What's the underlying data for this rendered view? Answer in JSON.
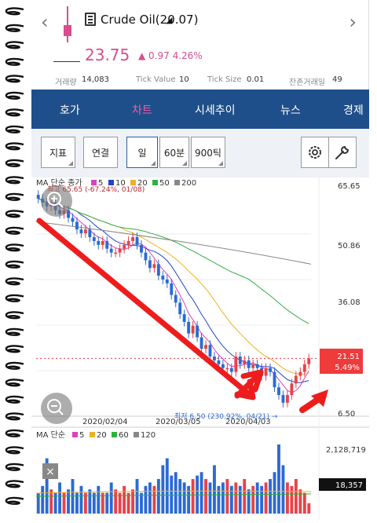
{
  "header": {
    "title": "Crude Oil(20.07)",
    "price": "23.75",
    "change": "▲ 0.97 4.26%"
  },
  "info": {
    "volume_label": "거래량",
    "volume_value": "14,083",
    "tick_value_label": "Tick Value",
    "tick_value_value": "10",
    "tick_size_label": "Tick Size",
    "tick_size_value": "0.01",
    "days_left_label": "잔존거래일",
    "days_left_value": "49"
  },
  "tabs": [
    "호가",
    "차트",
    "시세추이",
    "뉴스",
    "경제"
  ],
  "active_tab_index": 1,
  "toolbar": {
    "indicator_label": "지표",
    "link_label": "연결",
    "day_label": "일",
    "min60_label": "60분",
    "tick900_label": "900틱",
    "settings_icon": "gear-icon",
    "tools_icon": "wrench-icon"
  },
  "colors": {
    "up": "#e8424a",
    "down": "#2a6ad6",
    "accent_pink": "#d94d8e",
    "tab_bg": "#1f4f8a",
    "annotation_red": "#ee1c1c"
  },
  "price_chart": {
    "legend_title": "MA 단순 종가",
    "legend_items": [
      {
        "label": "5",
        "color": "#e040c0"
      },
      {
        "label": "10",
        "color": "#2244cc"
      },
      {
        "label": "20",
        "color": "#f0b020"
      },
      {
        "label": "50",
        "color": "#30b040"
      },
      {
        "label": "200",
        "color": "#888888"
      }
    ],
    "high_annotation": "최고 65.65 (-67.24%, 01/08)",
    "low_annotation": "최저 6.50 (230.92%, 04/21) →",
    "y_ticks": [
      "65.65",
      "50.86",
      "36.08",
      "21.51",
      "6.50"
    ],
    "current_price_label": "21.51",
    "current_change_label": "5.49%",
    "x_ticks": [
      "2020/02/04",
      "2020/03/05",
      "2020/04/03"
    ]
  },
  "volume_chart": {
    "legend_title": "MA 단순",
    "legend_items": [
      {
        "label": "5",
        "color": "#e040c0"
      },
      {
        "label": "20",
        "color": "#f0b020"
      },
      {
        "label": "60",
        "color": "#30b040"
      },
      {
        "label": "120",
        "color": "#888888"
      }
    ],
    "y_ticks": [
      "2,128,719"
    ],
    "current_volume_label": "18,357"
  },
  "chart_data": {
    "type": "candlestick",
    "ylim": [
      6.5,
      65.65
    ],
    "closes": [
      63,
      62,
      61,
      62,
      60,
      59,
      60,
      58,
      57,
      55,
      54,
      55,
      53,
      52,
      51,
      52,
      50,
      49,
      49,
      50,
      51,
      52,
      53,
      51,
      49,
      47,
      45,
      46,
      43,
      42,
      41,
      38,
      36,
      33,
      31,
      28,
      30,
      27,
      24,
      25,
      22,
      21,
      20,
      19,
      19,
      18,
      22,
      20,
      21,
      19,
      20,
      19,
      17,
      19,
      18,
      14,
      12,
      10,
      12,
      15,
      17,
      18,
      20,
      21.51
    ],
    "volumes": [
      0.3,
      0.4,
      0.8,
      0.35,
      0.3,
      0.45,
      0.3,
      0.35,
      0.5,
      0.3,
      0.4,
      0.3,
      0.35,
      0.3,
      0.4,
      0.3,
      0.3,
      0.45,
      0.35,
      0.3,
      0.4,
      0.3,
      0.35,
      0.5,
      0.3,
      0.4,
      0.45,
      0.4,
      0.5,
      0.7,
      0.8,
      0.55,
      0.6,
      0.5,
      0.45,
      0.4,
      0.5,
      0.55,
      0.6,
      0.5,
      0.45,
      0.7,
      0.4,
      0.45,
      0.5,
      0.4,
      0.45,
      0.4,
      0.5,
      0.35,
      0.4,
      0.45,
      0.4,
      0.45,
      0.5,
      0.6,
      1.0,
      0.7,
      0.45,
      0.4,
      0.5,
      0.35,
      0.3,
      0.15
    ]
  }
}
